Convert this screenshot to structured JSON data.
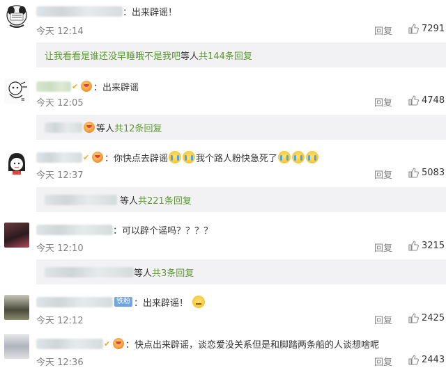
{
  "comments": [
    {
      "text": "：出来辟谣！",
      "time": "今天 12:14",
      "reply": "回复",
      "likes": "7291",
      "sub": {
        "lead": "让我看看是谁还没早睡哦不是我吧",
        "mid": " 等人 ",
        "count": "共144条回复"
      }
    },
    {
      "text": "：出来辟谣",
      "time": "今天 12:05",
      "reply": "回复",
      "likes": "4748",
      "sub": {
        "mid": "等人 ",
        "count": "共12条回复"
      }
    },
    {
      "text_a": "：你快点去辟谣",
      "text_b": "我个路人粉快急死了",
      "time": "今天 12:37",
      "reply": "回复",
      "likes": "5083",
      "sub": {
        "mid": "等人 ",
        "count": "共221条回复"
      }
    },
    {
      "text": "：可以辟个谣吗？？？？",
      "time": "今天 12:10",
      "reply": "回复",
      "likes": "3215",
      "sub": {
        "mid": "等人 ",
        "count": "共3条回复"
      }
    },
    {
      "badge": "铁粉",
      "text": "：出来辟谣！",
      "time": "今天 12:12",
      "reply": "回复",
      "likes": "2425"
    },
    {
      "text": "：快点出来辟谣，谈恋爱没关系但是和脚踏两条船的人谈想啥呢",
      "time": "今天 12:36",
      "reply": "回复",
      "likes": "2443"
    }
  ],
  "icons": {
    "like": "thumbs-up-icon",
    "verified": "v-badge-icon",
    "fan_medal": "fan-medal-icon"
  },
  "colors": {
    "link_green": "#5a9a2e",
    "muted": "#808080",
    "sub_bg": "#f2f2f5"
  }
}
